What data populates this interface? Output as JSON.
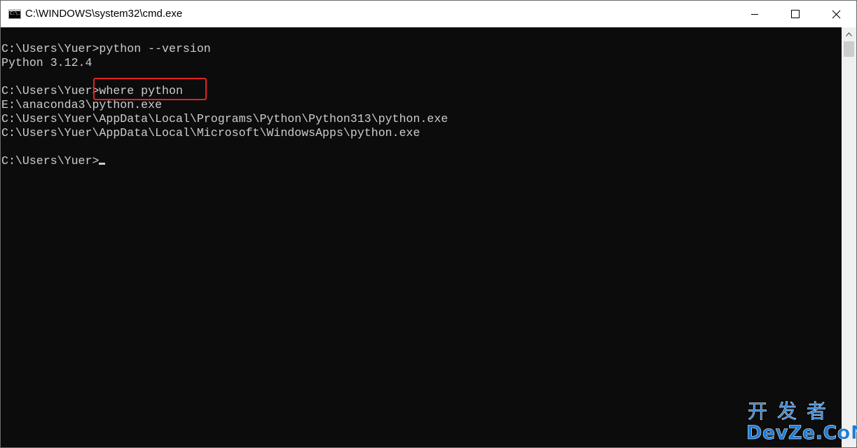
{
  "window": {
    "title": "C:\\WINDOWS\\system32\\cmd.exe",
    "icon_label": "C:\\."
  },
  "terminal": {
    "lines": [
      "C:\\Users\\Yuer>python --version",
      "Python 3.12.4",
      "",
      "C:\\Users\\Yuer>where python",
      "E:\\anaconda3\\python.exe",
      "C:\\Users\\Yuer\\AppData\\Local\\Programs\\Python\\Python313\\python.exe",
      "C:\\Users\\Yuer\\AppData\\Local\\Microsoft\\WindowsApps\\python.exe",
      "",
      "C:\\Users\\Yuer>"
    ],
    "highlighted_command": "where python"
  },
  "watermark": {
    "chinese": "开发者",
    "english": "DevZe.CoM"
  },
  "colors": {
    "terminal_bg": "#0c0c0c",
    "terminal_text": "#cccccc",
    "highlight_border": "#e02424",
    "watermark": "#1e7bd6"
  },
  "icons": [
    "cmd-app-icon",
    "minimize-icon",
    "maximize-icon",
    "close-icon",
    "scroll-up-arrow-icon"
  ]
}
